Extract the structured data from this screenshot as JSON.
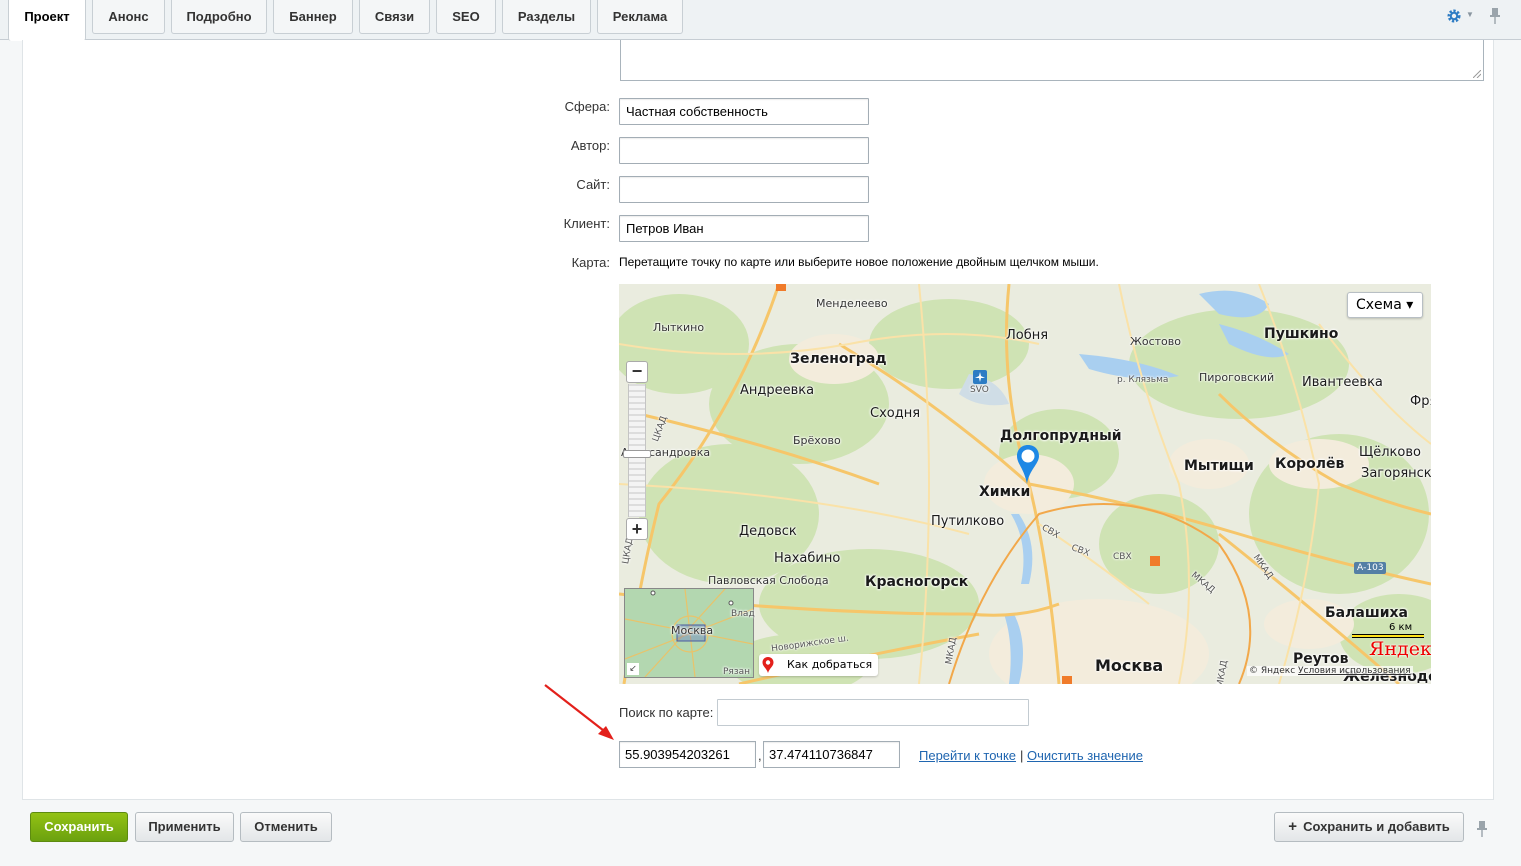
{
  "tabs": [
    {
      "label": "Проект",
      "active": true
    },
    {
      "label": "Анонс"
    },
    {
      "label": "Подробно"
    },
    {
      "label": "Баннер"
    },
    {
      "label": "Связи"
    },
    {
      "label": "SEO"
    },
    {
      "label": "Разделы"
    },
    {
      "label": "Реклама"
    }
  ],
  "tab_icons": {
    "settings": "gear-icon",
    "settings_dropdown": "caret-down-icon",
    "pin": "pin-icon"
  },
  "fields": {
    "sphere": {
      "label": "Сфера:",
      "value": "Частная собственность"
    },
    "author": {
      "label": "Автор:",
      "value": ""
    },
    "site": {
      "label": "Сайт:",
      "value": ""
    },
    "client": {
      "label": "Клиент:",
      "value": "Петров Иван"
    },
    "map": {
      "label": "Карта:",
      "hint": "Перетащите точку по карте или выберите новое положение двойным щелчком мыши."
    }
  },
  "map": {
    "type_button": "Схема ▾",
    "zoom_in": "+",
    "zoom_out": "−",
    "route_button": "Как добраться",
    "scale": "6 км",
    "logo": "Яндекс",
    "copyright": "© Яндекс",
    "terms_link": "Условия использования",
    "marker_color": "#1e88e5",
    "labels": {
      "mendeleevo": "Менделеево",
      "lytkino": "Лыткино",
      "lobnya": "Лобня",
      "pushkino": "Пушкино",
      "zhostovo": "Жостово",
      "zelenograd": "Зеленоград",
      "klyazma": "р. Клязьма",
      "pirogovsky": "Пироговский",
      "ivanteevka": "Ивантеевка",
      "andreevka": "Андреевка",
      "svo": "SVO",
      "skhodnya": "Сходня",
      "fryazino": "Фря",
      "dolgoprudny": "Долгопрудный",
      "brekhovo": "Брёхово",
      "shchelkovo": "Щёлково",
      "aleksandrovka": "Александровка",
      "mytishchi": "Мытищи",
      "korolev": "Королёв",
      "zagoryansky": "Загорянский",
      "khimki": "Химки",
      "putilkovo": "Путилково",
      "dedovsk": "Дедовск",
      "nakhabino": "Нахабино",
      "krasnogorsk": "Красногорск",
      "pavlovskaya": "Павловская Слобода",
      "balashikha": "Балашиха",
      "novorizhskoe": "Новорижское ш.",
      "reutov": "Реутов",
      "moskva": "Москва",
      "zheleznodor": "Железнодор",
      "minimap_city": "Москва",
      "vlad": "Влад",
      "ryazan": "Рязан",
      "ckad1": "ЦКАД",
      "ckad2": "ЦКАД",
      "svh1": "СВХ",
      "svh2": "СВХ",
      "svh3": "СВХ",
      "mkad1": "МКАД",
      "mkad2": "МКАД",
      "mkad3": "МКАД",
      "mkad4": "МКАД",
      "a103": "А-103"
    }
  },
  "search": {
    "label": "Поиск по карте:",
    "value": ""
  },
  "coords": {
    "lat": "55.903954203261",
    "lon": "37.474110736847",
    "separator": ","
  },
  "links": {
    "goto": "Перейти к точке",
    "separator": "|",
    "clear": "Очистить значение"
  },
  "buttons": {
    "save": "Сохранить",
    "apply": "Применить",
    "cancel": "Отменить",
    "save_add": "Сохранить и добавить"
  },
  "colors": {
    "save_green": "#7ab010",
    "link_blue": "#2066b0",
    "annotation_arrow": "#e3201b"
  }
}
